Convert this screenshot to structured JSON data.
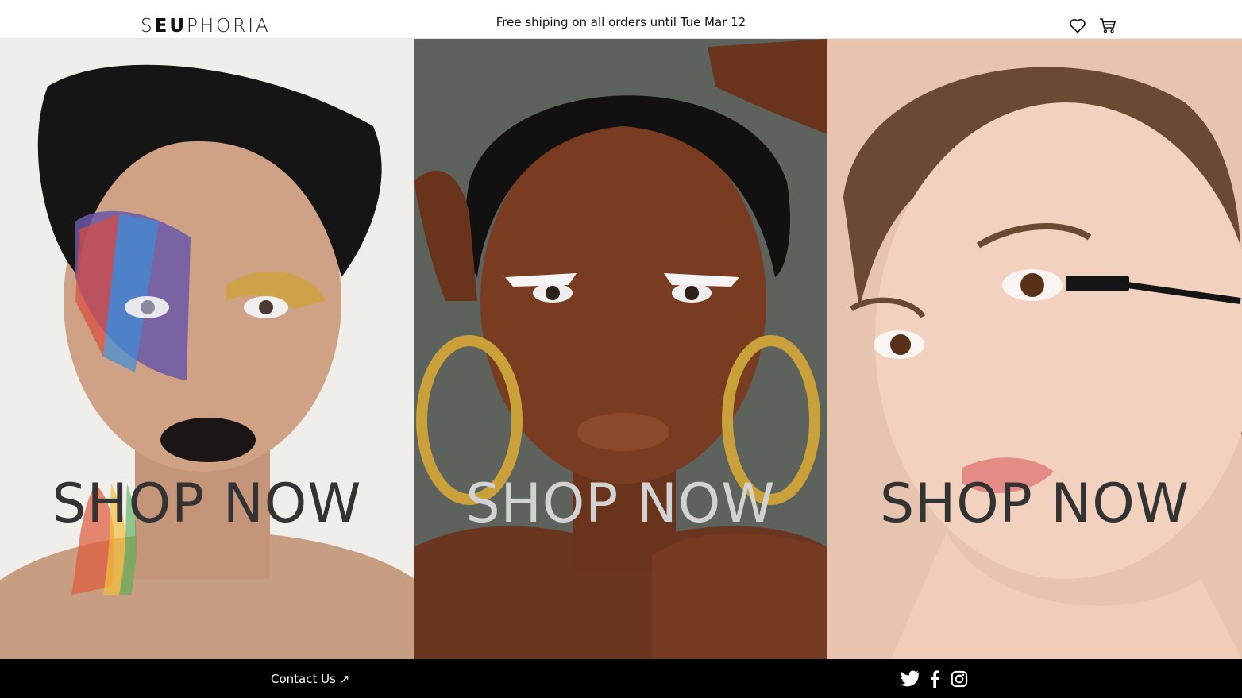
{
  "header": {
    "brand_light_1": "S",
    "brand_bold": "EU",
    "brand_light_2": "PHORIA",
    "promo_text": "Free shiping on all orders until Tue Mar 12",
    "icons": [
      "heart-icon",
      "cart-icon"
    ]
  },
  "panels": [
    {
      "cta_label": "SHOP NOW",
      "cta_color": "#333333",
      "background": "#efeeea"
    },
    {
      "cta_label": "SHOP NOW",
      "cta_color": "#d2d2d2",
      "background": "#5d625d"
    },
    {
      "cta_label": "SHOP NOW",
      "cta_color": "#333333",
      "background": "#e7c4b0"
    }
  ],
  "footer": {
    "contact_label": "Contact Us ↗",
    "socials": [
      "twitter-icon",
      "facebook-icon",
      "instagram-icon"
    ]
  }
}
